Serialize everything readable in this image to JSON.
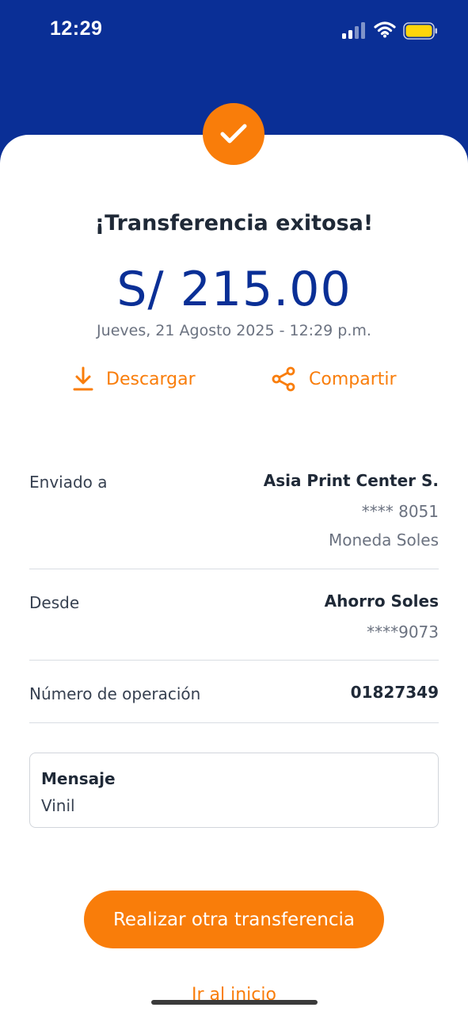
{
  "status_bar": {
    "time": "12:29",
    "icons": [
      "cellular-signal-icon",
      "wifi-icon",
      "battery-icon"
    ],
    "battery_color": "#ffd60a"
  },
  "colors": {
    "header_blue": "#0a2f96",
    "accent_orange": "#f97d0a"
  },
  "result": {
    "icon": "check-icon",
    "title": "¡Transferencia exitosa!",
    "amount": "S/ 215.00",
    "datetime": "Jueves, 21 Agosto 2025 - 12:29 p.m."
  },
  "actions": {
    "download": {
      "icon": "download-icon",
      "label": "Descargar"
    },
    "share": {
      "icon": "share-icon",
      "label": "Compartir"
    }
  },
  "details": {
    "sent_to": {
      "label": "Enviado a",
      "name": "Asia Print Center S.",
      "account": "**** 8051",
      "currency": "Moneda Soles"
    },
    "from": {
      "label": "Desde",
      "account_name": "Ahorro Soles",
      "account": "****9073"
    },
    "operation": {
      "label": "Número de operación",
      "value": "01827349"
    }
  },
  "message": {
    "label": "Mensaje",
    "value": "Vinil"
  },
  "buttons": {
    "another_transfer": "Realizar otra transferencia",
    "go_home": "Ir al inicio"
  }
}
